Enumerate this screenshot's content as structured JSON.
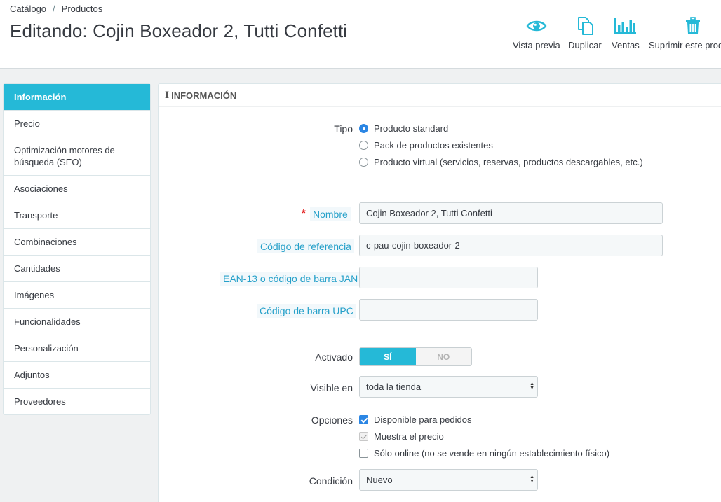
{
  "breadcrumb": {
    "item1": "Catálogo",
    "separator": "/",
    "item2": "Productos"
  },
  "page": {
    "title": "Editando: Cojin Boxeador 2, Tutti Confetti"
  },
  "toolbar": {
    "preview": {
      "label": "Vista previa",
      "icon": "eye-icon"
    },
    "duplicate": {
      "label": "Duplicar",
      "icon": "copy-icon"
    },
    "sales": {
      "label": "Ventas",
      "icon": "bar-chart-icon"
    },
    "delete": {
      "label": "Suprimir este producto",
      "icon": "trash-icon"
    }
  },
  "colors": {
    "accent": "#25b9d7",
    "link": "#25a0c9",
    "primary_control": "#2b86e4",
    "required": "#e31b1b"
  },
  "tabs": [
    {
      "label": "Información",
      "active": true
    },
    {
      "label": "Precio"
    },
    {
      "label": "Optimización motores de búsqueda (SEO)"
    },
    {
      "label": "Asociaciones"
    },
    {
      "label": "Transporte"
    },
    {
      "label": "Combinaciones"
    },
    {
      "label": "Cantidades"
    },
    {
      "label": "Imágenes"
    },
    {
      "label": "Funcionalidades"
    },
    {
      "label": "Personalización"
    },
    {
      "label": "Adjuntos"
    },
    {
      "label": "Proveedores"
    }
  ],
  "panel": {
    "heading_icon": "i",
    "heading": "Información",
    "type": {
      "label": "Tipo",
      "options": [
        {
          "label": "Producto standard",
          "selected": true
        },
        {
          "label": "Pack de productos existentes",
          "selected": false
        },
        {
          "label": "Producto virtual (servicios, reservas, productos descargables, etc.)",
          "selected": false
        }
      ]
    },
    "name": {
      "required_marker": "*",
      "label": "Nombre",
      "value": "Cojin Boxeador 2, Tutti Confetti"
    },
    "reference": {
      "label": "Código de referencia",
      "value": "c-pau-cojin-boxeador-2"
    },
    "ean13": {
      "label": "EAN-13 o código de barra JAN",
      "value": ""
    },
    "upc": {
      "label": "Código de barra UPC",
      "value": ""
    },
    "active": {
      "label": "Activado",
      "yes": "SÍ",
      "no": "NO",
      "value": "yes"
    },
    "visibility": {
      "label": "Visible en",
      "value": "toda la tienda"
    },
    "options": {
      "label": "Opciones",
      "items": [
        {
          "label": "Disponible para pedidos",
          "checked": true
        },
        {
          "label": "Muestra el precio",
          "checked": true,
          "disabled": true
        },
        {
          "label": "Sólo online (no se vende en ningún establecimiento físico)",
          "checked": false
        }
      ]
    },
    "condition": {
      "label": "Condición",
      "value": "Nuevo"
    }
  }
}
